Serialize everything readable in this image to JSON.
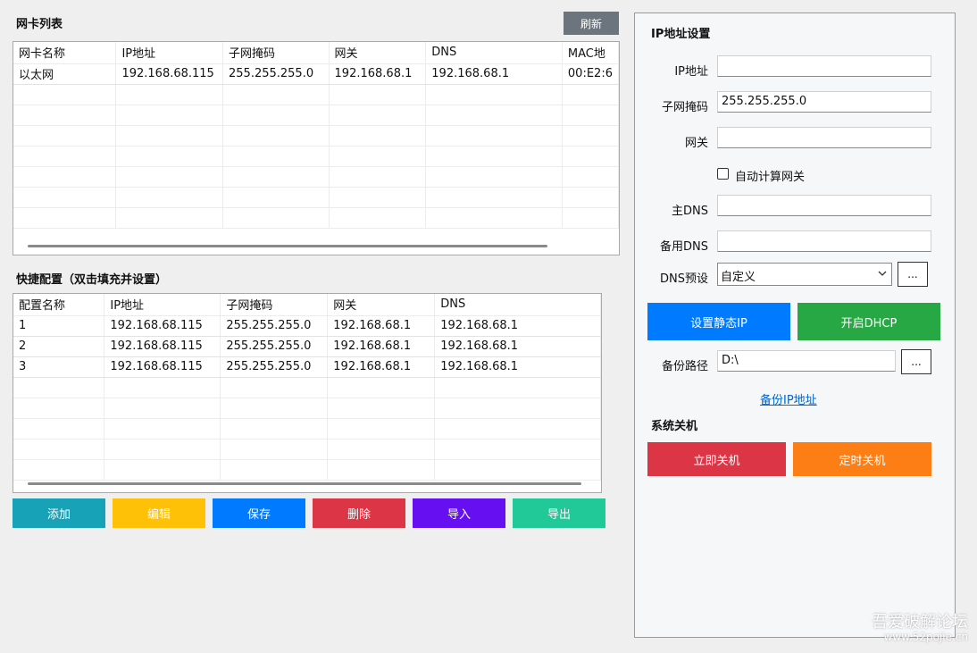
{
  "nic_list": {
    "title": "网卡列表",
    "refresh_label": "刷新",
    "columns": [
      "网卡名称",
      "IP地址",
      "子网掩码",
      "网关",
      "DNS",
      "MAC地"
    ],
    "rows": [
      [
        "以太网",
        "192.168.68.115",
        "255.255.255.0",
        "192.168.68.1",
        "192.168.68.1",
        "00:E2:6"
      ]
    ]
  },
  "quick_config": {
    "title": "快捷配置（双击填充并设置）",
    "columns": [
      "配置名称",
      "IP地址",
      "子网掩码",
      "网关",
      "DNS"
    ],
    "rows": [
      [
        "1",
        "192.168.68.115",
        "255.255.255.0",
        "192.168.68.1",
        "192.168.68.1"
      ],
      [
        "2",
        "192.168.68.115",
        "255.255.255.0",
        "192.168.68.1",
        "192.168.68.1"
      ],
      [
        "3",
        "192.168.68.115",
        "255.255.255.0",
        "192.168.68.1",
        "192.168.68.1"
      ]
    ]
  },
  "actions": {
    "add": "添加",
    "edit": "编辑",
    "save": "保存",
    "delete": "删除",
    "import": "导入",
    "export": "导出"
  },
  "ip_settings": {
    "title": "IP地址设置",
    "ip_label": "IP地址",
    "ip_value": "",
    "mask_label": "子网掩码",
    "mask_value": "255.255.255.0",
    "gateway_label": "网关",
    "gateway_value": "",
    "auto_gateway_label": "自动计算网关",
    "auto_gateway_checked": false,
    "dns1_label": "主DNS",
    "dns1_value": "",
    "dns2_label": "备用DNS",
    "dns2_value": "",
    "dns_preset_label": "DNS预设",
    "dns_preset_value": "自定义",
    "browse_label": "...",
    "set_static_label": "设置静态IP",
    "dhcp_label": "开启DHCP",
    "backup_path_label": "备份路径",
    "backup_path_value": "D:\\",
    "backup_link": "备份IP地址"
  },
  "shutdown": {
    "title": "系统关机",
    "now_label": "立即关机",
    "timed_label": "定时关机"
  },
  "watermark": {
    "line1": "吾爱破解论坛",
    "line2": "www.52pojie.cn"
  },
  "colors": {
    "refresh": "#6c757d",
    "add": "#17a2b8",
    "edit": "#ffc107",
    "save": "#007bff",
    "delete": "#dc3545",
    "import": "#6610f2",
    "export": "#20c997",
    "static": "#007bff",
    "dhcp": "#28a745",
    "shutdown_now": "#dc3545",
    "shutdown_timed": "#fd7e14"
  }
}
